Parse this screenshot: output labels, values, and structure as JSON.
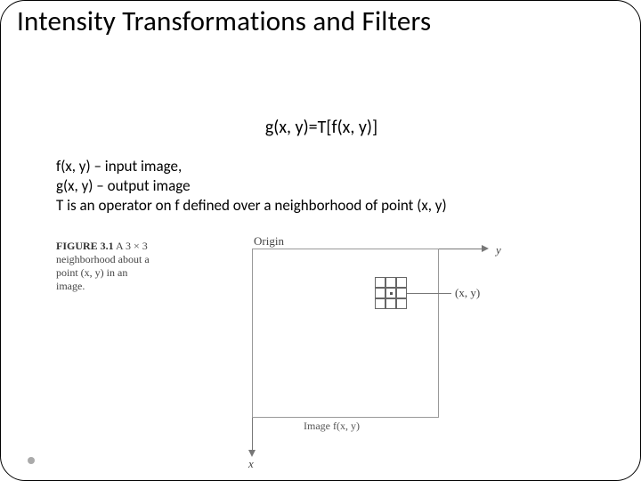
{
  "title": "Intensity Transformations and Filters",
  "formula": "g(x, y)=T[f(x, y)]",
  "defs": {
    "line1": "f(x, y) – input image,",
    "line2": "g(x, y) – output image",
    "line3": "T is an operator on f defined over a neighborhood of point (x, y)"
  },
  "caption": {
    "fignum": "FIGURE 3.1",
    "text": " A 3 × 3 neighborhood about a point (x, y) in an image."
  },
  "diagram": {
    "origin": "Origin",
    "y": "y",
    "x": "x",
    "point": "(x, y)",
    "image": "Image f(x, y)"
  }
}
